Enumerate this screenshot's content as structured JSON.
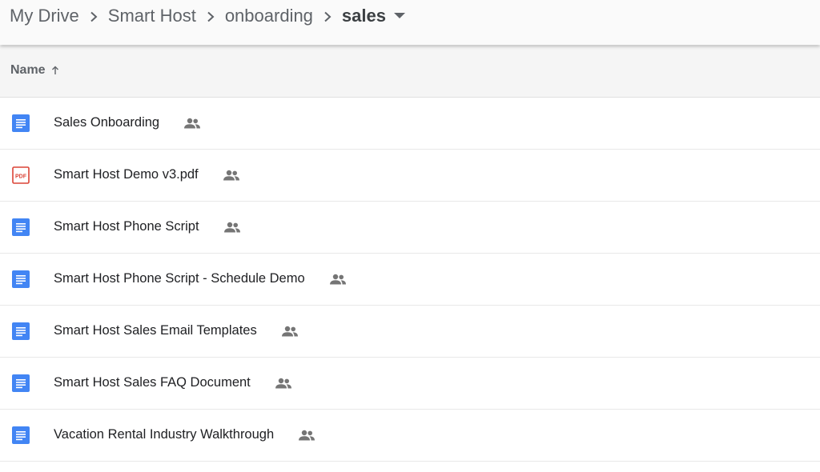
{
  "breadcrumb": {
    "items": [
      "My Drive",
      "Smart Host",
      "onboarding"
    ],
    "current": "sales"
  },
  "header": {
    "name_label": "Name"
  },
  "files": [
    {
      "name": "Sales Onboarding",
      "type": "doc",
      "shared": true
    },
    {
      "name": "Smart Host Demo v3.pdf",
      "type": "pdf",
      "shared": true
    },
    {
      "name": "Smart Host Phone Script",
      "type": "doc",
      "shared": true
    },
    {
      "name": "Smart Host Phone Script - Schedule Demo",
      "type": "doc",
      "shared": true
    },
    {
      "name": "Smart Host Sales Email Templates",
      "type": "doc",
      "shared": true
    },
    {
      "name": "Smart Host Sales FAQ Document",
      "type": "doc",
      "shared": true
    },
    {
      "name": "Vacation Rental Industry Walkthrough",
      "type": "doc",
      "shared": true
    }
  ],
  "icons": {
    "doc": "docs-file-icon",
    "pdf": "pdf-file-icon",
    "shared": "shared-people-icon"
  },
  "colors": {
    "doc_blue": "#4285f4",
    "pdf_red": "#db4437",
    "icon_gray": "#757575"
  }
}
